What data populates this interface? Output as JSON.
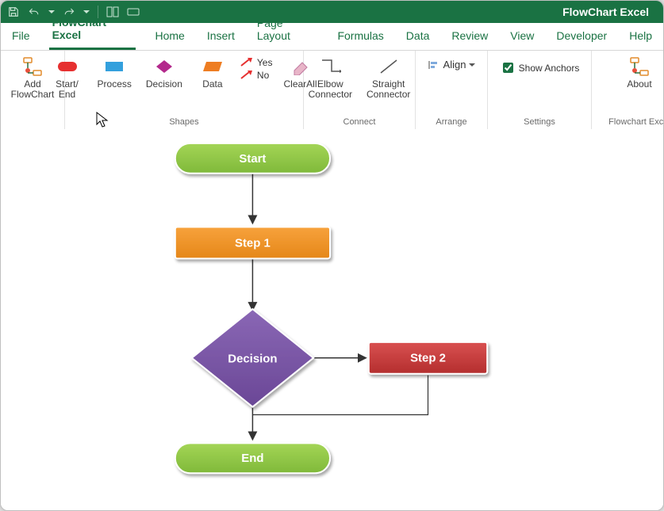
{
  "app": {
    "title": "FlowChart Excel"
  },
  "tabs": {
    "file": "File",
    "flowchart": "FlowChart Excel",
    "home": "Home",
    "insert": "Insert",
    "page_layout": "Page Layout",
    "formulas": "Formulas",
    "data": "Data",
    "review": "Review",
    "view": "View",
    "developer": "Developer",
    "help": "Help"
  },
  "ribbon": {
    "add_flowchart": "Add\nFlowChart",
    "shapes": {
      "start_end": "Start/\nEnd",
      "process": "Process",
      "decision": "Decision",
      "data": "Data",
      "yes": "Yes",
      "no": "No",
      "clear_all": "ClearAll",
      "group_label": "Shapes"
    },
    "connect": {
      "elbow": "Elbow\nConnector",
      "straight": "Straight\nConnector",
      "group_label": "Connect"
    },
    "arrange": {
      "align": "Align",
      "group_label": "Arrange"
    },
    "settings": {
      "show_anchors": "Show Anchors",
      "group_label": "Settings"
    },
    "about": {
      "about": "About",
      "group_label": "Flowchart Excel"
    }
  },
  "flow": {
    "start": "Start",
    "step1": "Step 1",
    "decision": "Decision",
    "step2": "Step 2",
    "end": "End"
  }
}
